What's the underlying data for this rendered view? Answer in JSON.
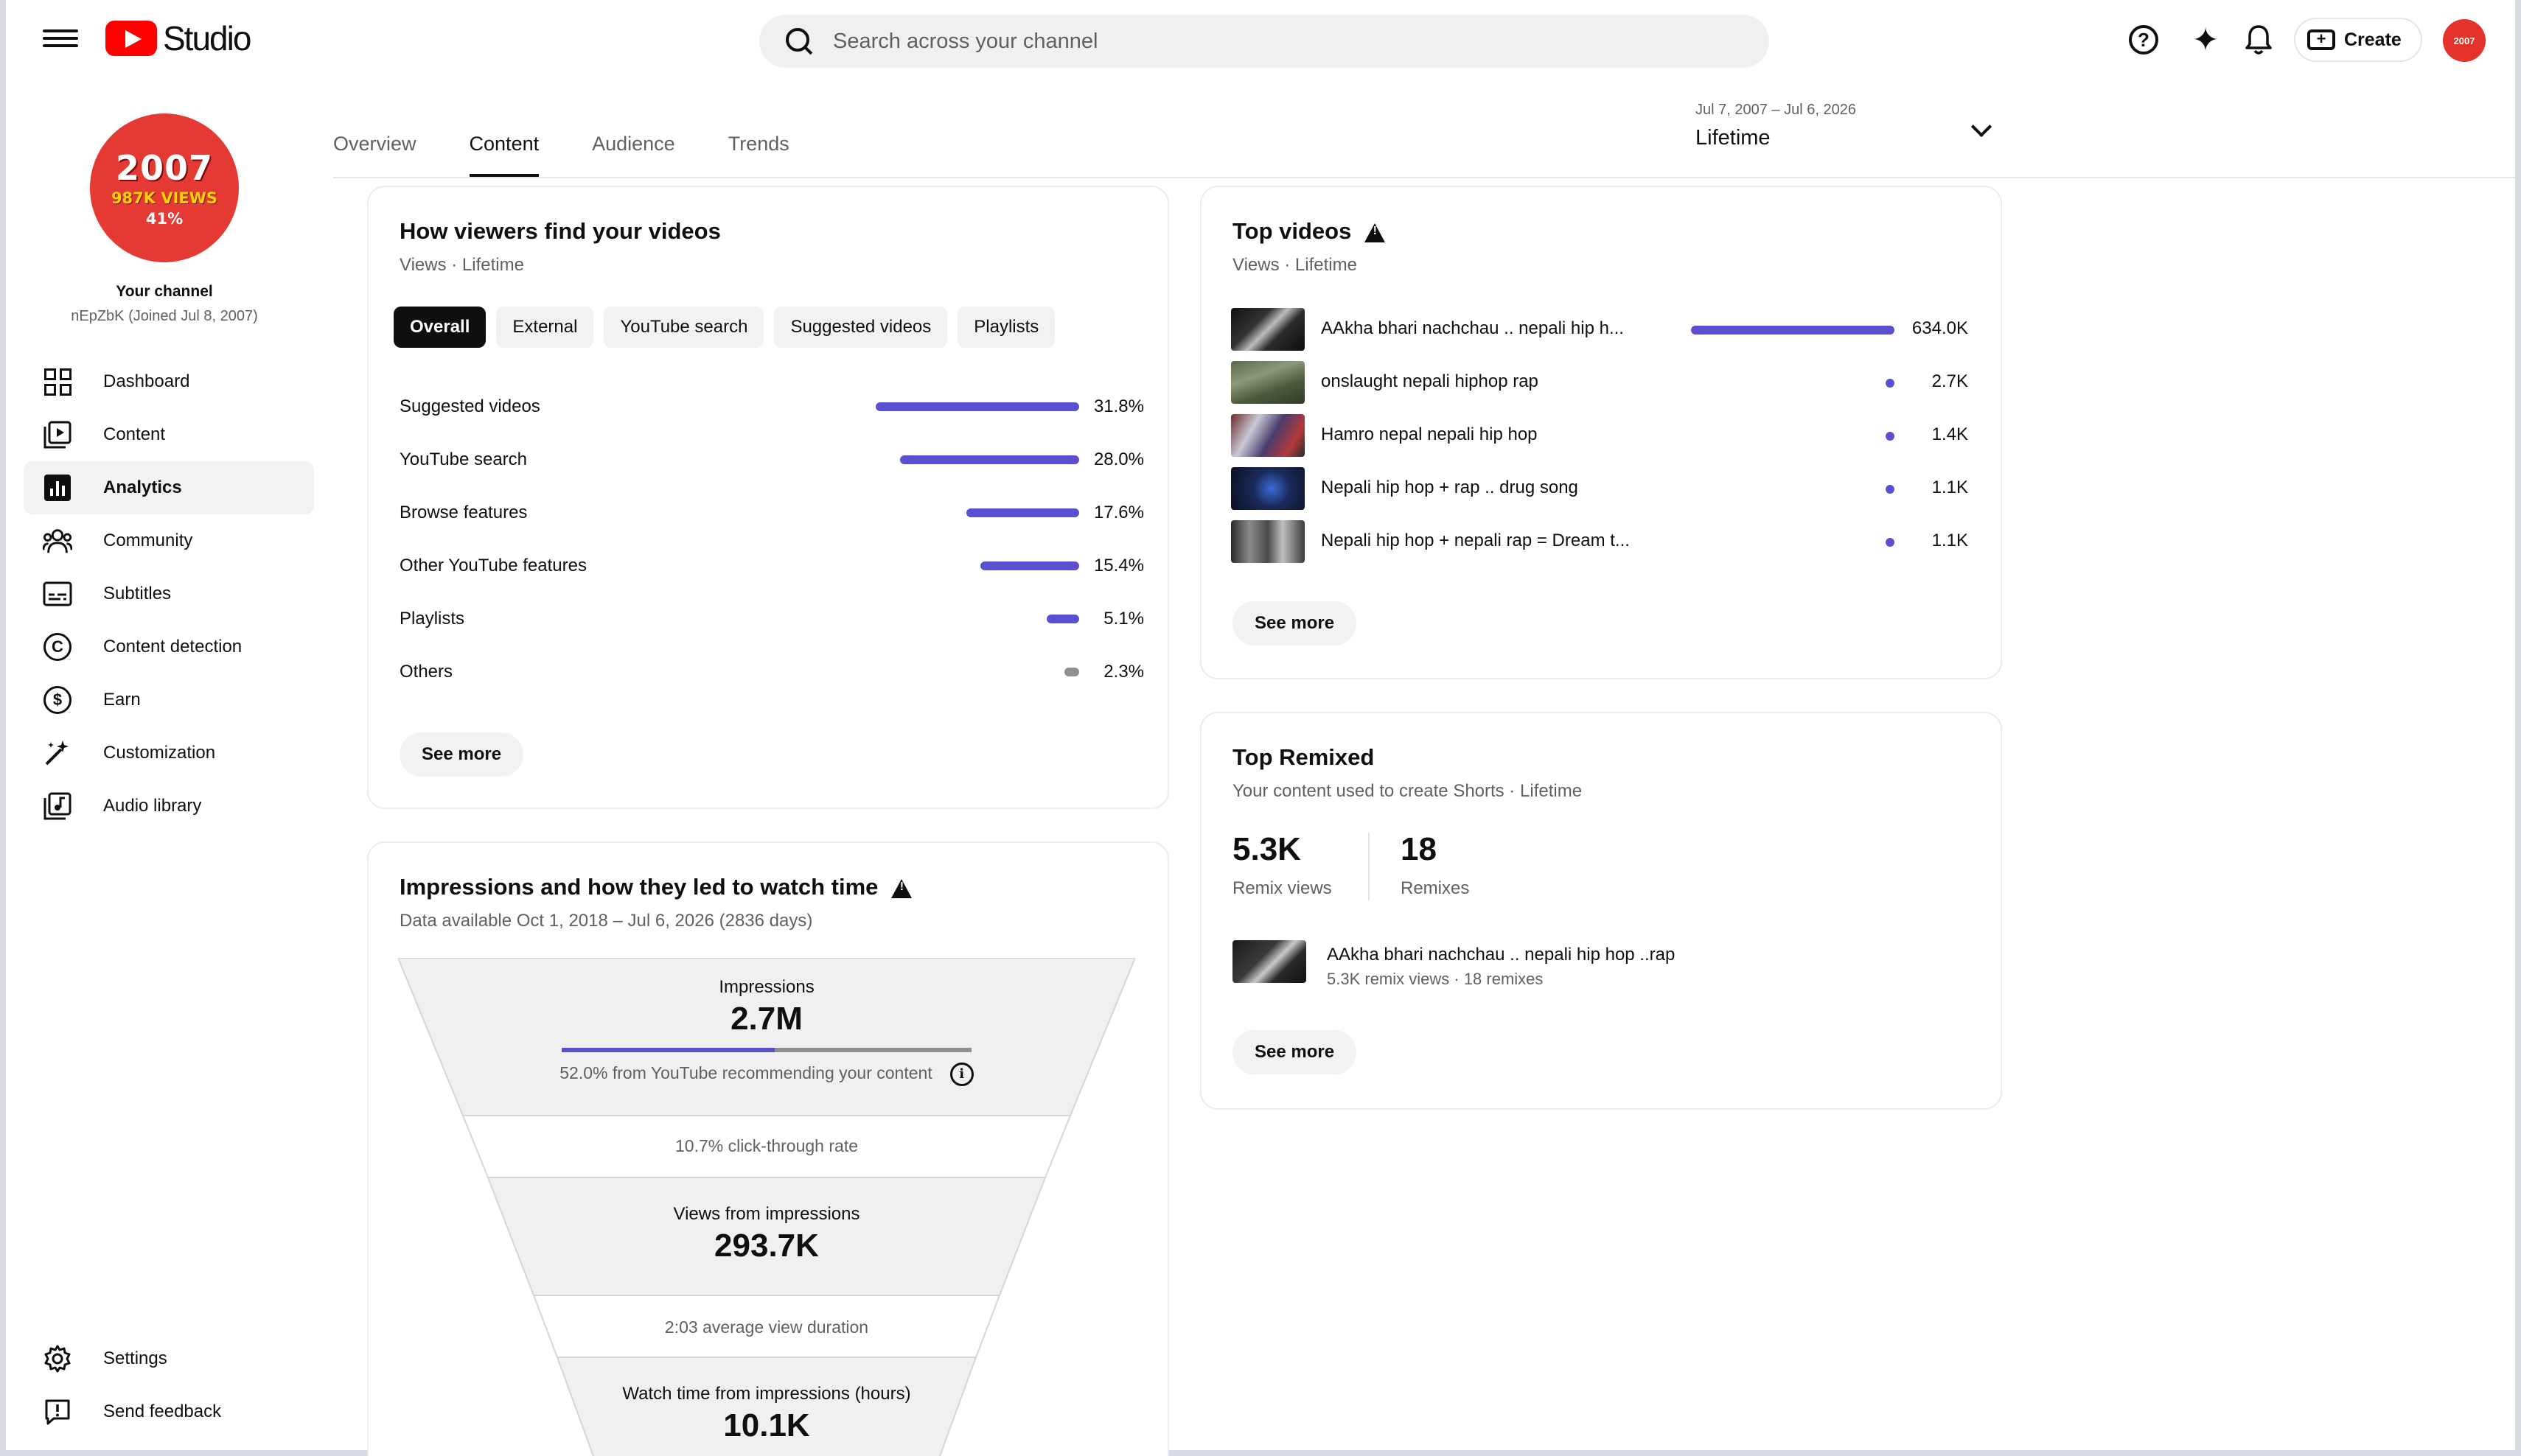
{
  "header": {
    "logo_text": "Studio",
    "search_placeholder": "Search across your channel",
    "create_label": "Create",
    "avatar_text": "2007"
  },
  "sidebar": {
    "avatar": {
      "year": "2007",
      "views": "987K VIEWS",
      "percent": "41%"
    },
    "your_channel": "Your channel",
    "handle": "nEpZbK (Joined Jul 8, 2007)",
    "items": [
      {
        "label": "Dashboard",
        "icon": "dashboard-icon"
      },
      {
        "label": "Content",
        "icon": "content-icon"
      },
      {
        "label": "Analytics",
        "icon": "analytics-icon",
        "active": true
      },
      {
        "label": "Community",
        "icon": "community-icon"
      },
      {
        "label": "Subtitles",
        "icon": "subtitles-icon"
      },
      {
        "label": "Content detection",
        "icon": "copyright-icon"
      },
      {
        "label": "Earn",
        "icon": "dollar-icon"
      },
      {
        "label": "Customization",
        "icon": "magic-wand-icon"
      },
      {
        "label": "Audio library",
        "icon": "audio-library-icon"
      }
    ],
    "bottom_items": [
      {
        "label": "Settings",
        "icon": "gear-icon"
      },
      {
        "label": "Send feedback",
        "icon": "feedback-icon"
      }
    ]
  },
  "tabs": [
    "Overview",
    "Content",
    "Audience",
    "Trends"
  ],
  "active_tab": "Content",
  "date_picker": {
    "range": "Jul 7, 2007 – Jul 6, 2026",
    "period": "Lifetime"
  },
  "traffic_sources": {
    "title": "How viewers find your videos",
    "subtitle": "Views · Lifetime",
    "chips": [
      "Overall",
      "External",
      "YouTube search",
      "Suggested videos",
      "Playlists"
    ],
    "active_chip": "Overall",
    "rows": [
      {
        "label": "Suggested videos",
        "value": "31.8%",
        "pct": 31.8
      },
      {
        "label": "YouTube search",
        "value": "28.0%",
        "pct": 28.0
      },
      {
        "label": "Browse features",
        "value": "17.6%",
        "pct": 17.6
      },
      {
        "label": "Other YouTube features",
        "value": "15.4%",
        "pct": 15.4
      },
      {
        "label": "Playlists",
        "value": "5.1%",
        "pct": 5.1
      },
      {
        "label": "Others",
        "value": "2.3%",
        "pct": 2.3
      }
    ],
    "see_more": "See more"
  },
  "top_videos": {
    "title": "Top videos",
    "subtitle": "Views · Lifetime",
    "videos": [
      {
        "title": "AAkha bhari nachchau .. nepali hip h...",
        "views": "634.0K",
        "value": 634000
      },
      {
        "title": "onslaught nepali hiphop rap",
        "views": "2.7K",
        "value": 2700
      },
      {
        "title": "Hamro nepal nepali hip hop",
        "views": "1.4K",
        "value": 1400
      },
      {
        "title": "Nepali hip hop + rap .. drug song",
        "views": "1.1K",
        "value": 1100
      },
      {
        "title": "Nepali hip hop + nepali rap = Dream t...",
        "views": "1.1K",
        "value": 1100
      }
    ],
    "see_more": "See more"
  },
  "top_remixed": {
    "title": "Top Remixed",
    "subtitle": "Your content used to create Shorts · Lifetime",
    "remix_views": "5.3K",
    "remix_views_label": "Remix views",
    "remixes": "18",
    "remixes_label": "Remixes",
    "video": {
      "title": "AAkha bhari nachchau .. nepali hip hop ..rap",
      "meta": "5.3K remix views · 18 remixes"
    },
    "see_more": "See more"
  },
  "impressions": {
    "title": "Impressions and how they led to watch time",
    "subtitle": "Data available Oct 1, 2018 – Jul 6, 2026 (2836 days)",
    "impressions_label": "Impressions",
    "impressions_value": "2.7M",
    "recommend_text": "52.0% from YouTube recommending your content",
    "recommend_pct": 52.0,
    "ctr_text": "10.7% click-through rate",
    "views_label": "Views from impressions",
    "views_value": "293.7K",
    "avd_text": "2:03 average view duration",
    "watch_label": "Watch time from impressions (hours)",
    "watch_value": "10.1K"
  },
  "colors": {
    "accent": "#5a4fcf",
    "brand": "#ff0000",
    "grey_bar": "#909090"
  }
}
